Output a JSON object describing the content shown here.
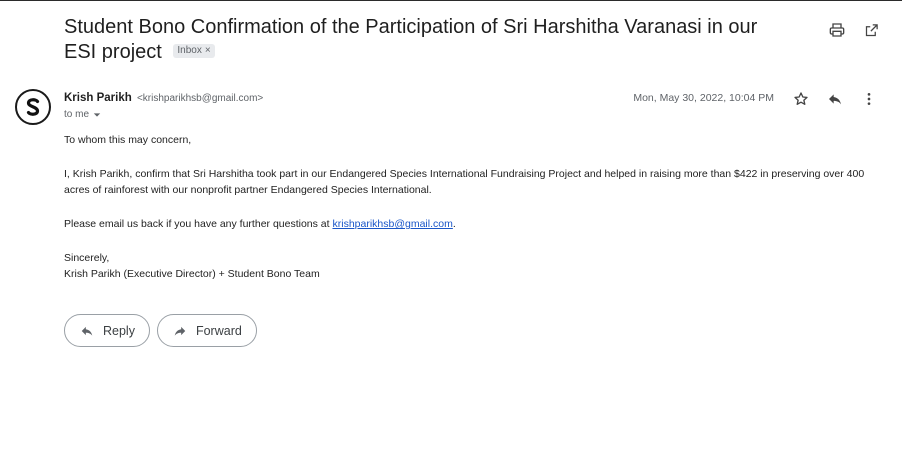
{
  "email": {
    "subject": "Student Bono Confirmation of the Participation of Sri Harshitha Varanasi in our ESI project",
    "label_chip": "Inbox",
    "label_chip_close": "×",
    "sender_name": "Krish Parikh",
    "sender_email": "<krishparikhsb@gmail.com>",
    "recipient": "to me",
    "date": "Mon, May 30, 2022, 10:04 PM",
    "body": {
      "greeting": "To whom this may concern,",
      "paragraph1": "I, Krish Parikh, confirm that Sri Harshitha took part in our Endangered Species International Fundraising Project and helped in raising more than $422 in preserving over 400 acres of rainforest with our nonprofit partner Endangered Species International.",
      "paragraph2_prefix": "Please email us back if you have any further questions at ",
      "paragraph2_link": "krishparikhsb@gmail.com",
      "paragraph2_suffix": ".",
      "closing": "Sincerely,",
      "signature": "Krish Parikh (Executive Director) + Student Bono Team"
    }
  },
  "actions": {
    "reply_label": "Reply",
    "forward_label": "Forward"
  },
  "icons": {
    "print": "print-icon",
    "open_new_window": "open-in-new-icon",
    "star": "star-icon",
    "reply": "reply-icon",
    "more": "more-vert-icon",
    "dropdown": "caret-down-icon",
    "forward": "forward-icon"
  },
  "colors": {
    "link": "#1a56c8",
    "muted": "#5f6368",
    "chip_bg": "#e8eaed"
  }
}
